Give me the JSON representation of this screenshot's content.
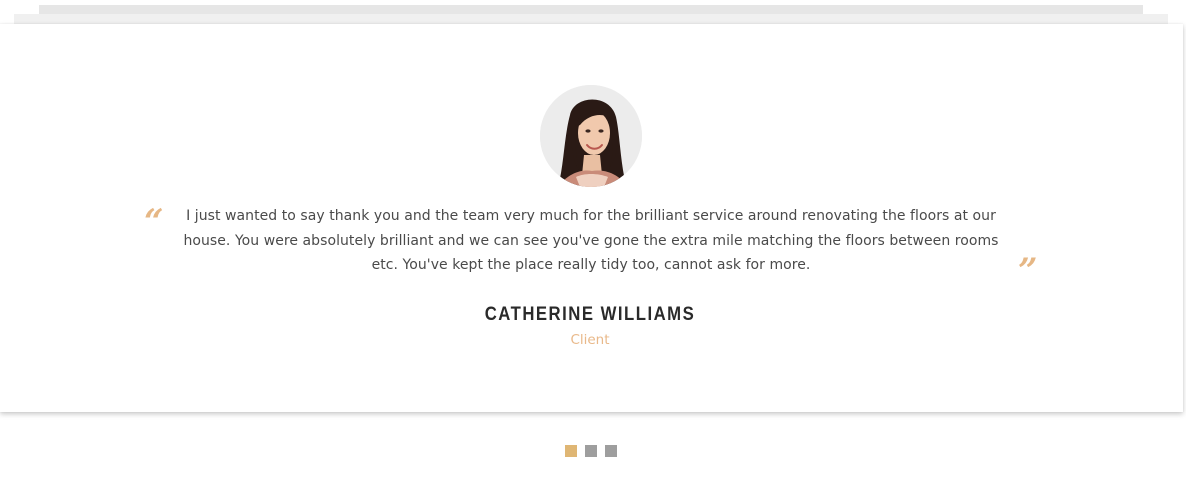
{
  "testimonial": {
    "quote": "I just wanted to say thank you and the team very much for the brilliant service around renovating the floors at our house. You were absolutely brilliant and we can see you've gone the extra mile matching the floors between rooms etc. You've kept the place really tidy too, cannot ask for more.",
    "author_name": "CATHERINE WILLIAMS",
    "author_role": "Client",
    "open_quote_glyph": "“",
    "close_quote_glyph": "”"
  },
  "pager": {
    "count": 3,
    "active_index": 0
  },
  "colors": {
    "accent": "#e6b785",
    "active_dot": "#dfb674",
    "inactive_dot": "#9e9e9e",
    "text": "#4a4a4a",
    "name": "#2a2a2a"
  }
}
